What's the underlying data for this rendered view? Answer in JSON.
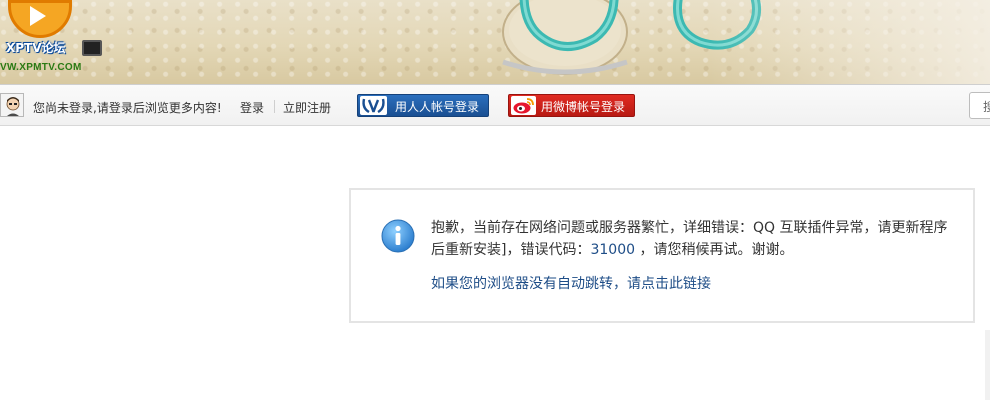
{
  "header": {
    "logo_name": "XPTV论坛",
    "logo_url": "VW.XPMTV.COM"
  },
  "loginbar": {
    "notice": "您尚未登录,请登录后浏览更多内容!",
    "login_label": "登录",
    "register_label": "立即注册",
    "renren_label": "用人人帐号登录",
    "weibo_label": "用微博帐号登录",
    "search_stub_label": "搜"
  },
  "message": {
    "text_before_code": "抱歉，当前存在网络问题或服务器繁忙，详细错误：QQ 互联插件异常，请更新程序后重新安装]，错误代码：",
    "error_code": "31000",
    "text_after_code": " ，请您稍候再试。谢谢。",
    "redirect_link": "如果您的浏览器没有自动跳转，请点击此链接"
  },
  "colors": {
    "link": "#1e4d87",
    "renren": "#1a4f92",
    "weibo": "#c41e17",
    "info_icon": "#3d8fd6"
  },
  "icons": {
    "info": "info-icon",
    "avatar": "user-avatar-icon",
    "renren": "renren-logo-icon",
    "weibo": "weibo-logo-icon"
  }
}
